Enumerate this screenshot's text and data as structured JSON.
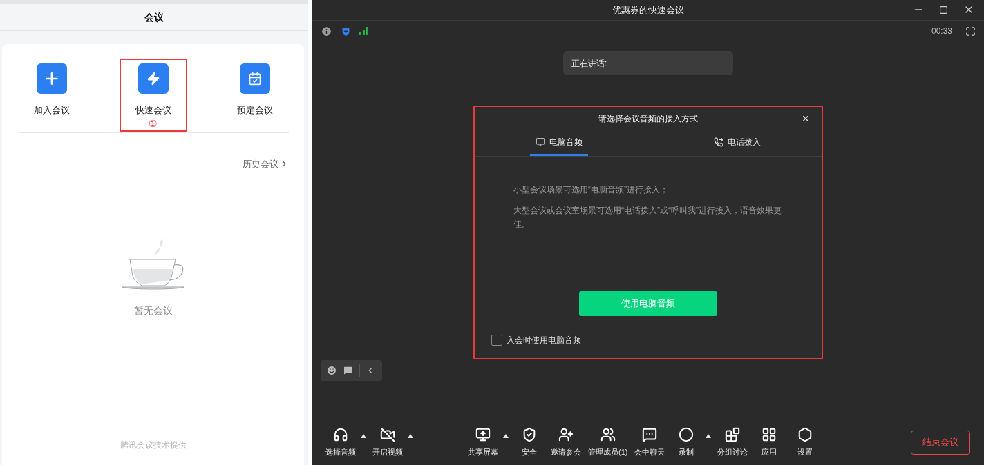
{
  "left_panel": {
    "title": "会议",
    "actions": [
      {
        "label": "加入会议",
        "annotated": false
      },
      {
        "label": "快速会议",
        "annotated": true,
        "marker": "①"
      },
      {
        "label": "预定会议",
        "annotated": false
      }
    ],
    "history_link": "历史会议",
    "empty_text": "暂无会议",
    "footer": "腾讯会议技术提供"
  },
  "meeting_window": {
    "title": "优惠券的快速会议",
    "timer": "00:33",
    "speaking_label": "正在讲话:",
    "dialog": {
      "annotated": true,
      "title": "请选择会议音频的接入方式",
      "close": "×",
      "tabs": [
        {
          "label": "电脑音频",
          "selected": true
        },
        {
          "label": "电话拨入",
          "selected": false
        }
      ],
      "paragraphs": [
        "小型会议场景可选用“电脑音频”进行接入；",
        "大型会议或会议室场景可选用“电话拨入”或“呼叫我”进行接入，语音效果更佳。"
      ],
      "primary_button": "使用电脑音频",
      "checkbox": {
        "label": "入会时使用电脑音频",
        "checked": false
      }
    },
    "toolbar": {
      "left_items": [
        {
          "label": "选择音频",
          "has_menu": true
        },
        {
          "label": "开启视频",
          "has_menu": true
        }
      ],
      "center_items": [
        {
          "label": "共享屏幕",
          "has_menu": true
        },
        {
          "label": "安全",
          "has_menu": false
        },
        {
          "label": "邀请参会",
          "has_menu": false
        },
        {
          "label": "管理成员(1)",
          "has_menu": false
        },
        {
          "label": "会中聊天",
          "has_menu": false
        },
        {
          "label": "录制",
          "has_menu": true
        },
        {
          "label": "分组讨论",
          "has_menu": false
        },
        {
          "label": "应用",
          "has_menu": false
        },
        {
          "label": "设置",
          "has_menu": false
        }
      ],
      "end_button": "结束会议"
    }
  }
}
